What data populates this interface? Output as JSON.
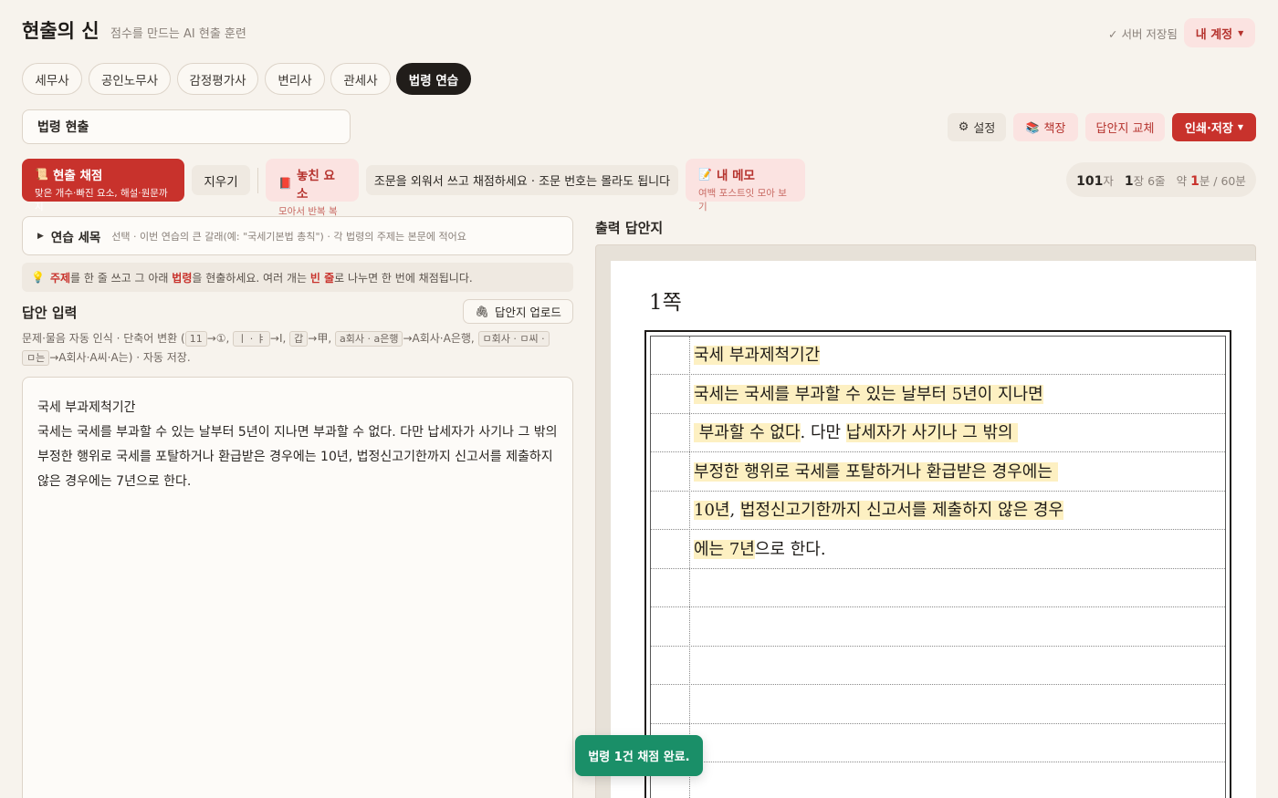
{
  "header": {
    "brand": "현출의 신",
    "tagline": "점수를 만드는 AI 현출 훈련",
    "saved_status": "✓ 서버 저장됨",
    "account_label": "내 계정"
  },
  "tabs": [
    {
      "label": "세무사",
      "active": false
    },
    {
      "label": "공인노무사",
      "active": false
    },
    {
      "label": "감정평가사",
      "active": false
    },
    {
      "label": "변리사",
      "active": false
    },
    {
      "label": "관세사",
      "active": false
    },
    {
      "label": "법령 연습",
      "active": true
    }
  ],
  "law_input": {
    "value": "법령 현출"
  },
  "toolbar": {
    "settings_label": "설정",
    "shelf_label": "책장",
    "swap_label": "답안지 교체",
    "print_label": "인쇄·저장"
  },
  "actions": {
    "grade_title": "현출 채점",
    "grade_sub": "맞은 개수·빠진 요소, 해설·원문까지",
    "clear_label": "지우기",
    "missed_title": "놓친 요소",
    "missed_sub": "모아서 반복 복습",
    "hint": "조문을 외워서 쓰고 채점하세요 · 조문 번호는 몰라도 됩니다",
    "memo_title": "내 메모",
    "memo_sub": "여백 포스트잇 모아 보기"
  },
  "stats": {
    "chars": "101",
    "chars_unit": "자",
    "pages": "1",
    "pages_unit": "장",
    "lines": "6줄",
    "time_prefix": "약",
    "minutes": "1",
    "time_suffix": "분 / 60분"
  },
  "practice": {
    "title_label": "연습 세목",
    "title_sub": "선택 · 이번 연습의 큰 갈래(예: \"국세기본법 총칙\") · 각 법령의 주제는 본문에 적어요"
  },
  "tip": {
    "p1": "주제",
    "p2": "를 한 줄 쓰고 그 아래",
    "p3": "법령",
    "p4": "을 현출하세요. 여러 개는",
    "p5": "빈 줄",
    "p6": "로 나누면 한 번에 채점됩니다."
  },
  "answer": {
    "heading": "답안 입력",
    "upload_label": "답안지 업로드",
    "help_prefix": "문제·물음 자동 인식 · 단축어 변환 (",
    "k1": "11",
    "a1": "→①,",
    "k2": "ㅣ · ㅑ",
    "a2": "→Ⅰ,",
    "k3": "갑",
    "a3": "→甲,",
    "k4": "a회사 · a은행",
    "a4": "→A회사·A은행,",
    "k5": "ㅁ회사 · ㅁ씨 ·",
    "k6": "ㅁ는",
    "help_suffix": "→A회사·A씨·A는) · 자동 저장.",
    "lines": [
      "국세 부과제척기간",
      "국세는 국세를 부과할 수 있는 날부터 5년이 지나면 부과할 수 없다. 다만 납세자가 사기나 그 밖의",
      "부정한 행위로 국세를 포탈하거나 환급받은 경우에는 10년, 법정신고기한까지 신고서를 제출하지",
      "않은 경우에는 7년으로 한다."
    ]
  },
  "output": {
    "heading": "출력 답안지",
    "page_label": "1쪽",
    "rows": [
      [
        {
          "t": "국세 부과제척기간",
          "h": true
        }
      ],
      [
        {
          "t": "국세는 국세를 부과할 수 있는 날부터 5년이 지나면",
          "h": true
        }
      ],
      [
        {
          "t": " 부과할 수 없다",
          "h": true
        },
        {
          "t": ". 다만 ",
          "h": false
        },
        {
          "t": "납세자가 사기나 그 밖의 ",
          "h": true
        }
      ],
      [
        {
          "t": "부정한 행위로 국세를 포탈하거나 환급받은 경우에는 ",
          "h": true
        }
      ],
      [
        {
          "t": "10년",
          "h": true
        },
        {
          "t": ", ",
          "h": false
        },
        {
          "t": "법정신고기한까지 신고서를 제출하지 않은 경우",
          "h": true
        }
      ],
      [
        {
          "t": "에는 7년",
          "h": true
        },
        {
          "t": "으로 한다.",
          "h": false
        }
      ]
    ]
  },
  "toast": "법령 1건 채점 완료.",
  "colors": {
    "accent": "#c8322c",
    "highlight": "#fdf0c2",
    "toast": "#1a8f68",
    "background": "#f7f3ed"
  }
}
